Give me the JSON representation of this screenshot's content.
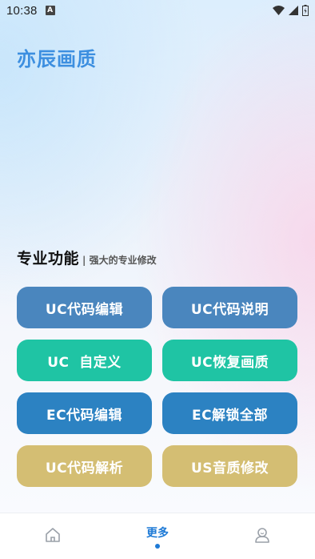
{
  "status_bar": {
    "time": "10:38",
    "notification_letter": "A",
    "icons": [
      "wifi-icon",
      "signal-icon",
      "battery-icon"
    ]
  },
  "app": {
    "title": "亦辰画质",
    "title_color": "#3d8fe0"
  },
  "section": {
    "title": "专业功能",
    "subtitle": "| 强大的专业修改"
  },
  "buttons": [
    {
      "label": "UC代码编辑",
      "color": "#4a86be"
    },
    {
      "label": "UC代码说明",
      "color": "#4a86be"
    },
    {
      "label": "UC  自定义",
      "color": "#1fc4a4"
    },
    {
      "label": "UC恢复画质",
      "color": "#1fc4a4"
    },
    {
      "label": "EC代码编辑",
      "color": "#2c82c2"
    },
    {
      "label": "EC解锁全部",
      "color": "#2c82c2"
    },
    {
      "label": "UC代码解析",
      "color": "#d4be73"
    },
    {
      "label": "US音质修改",
      "color": "#d4be73"
    }
  ],
  "bottom_nav": {
    "items": [
      {
        "icon": "home-icon",
        "label": ""
      },
      {
        "icon": "",
        "label": "更多",
        "active": true
      },
      {
        "icon": "user-icon",
        "label": ""
      }
    ],
    "active_color": "#1e7ad6"
  }
}
